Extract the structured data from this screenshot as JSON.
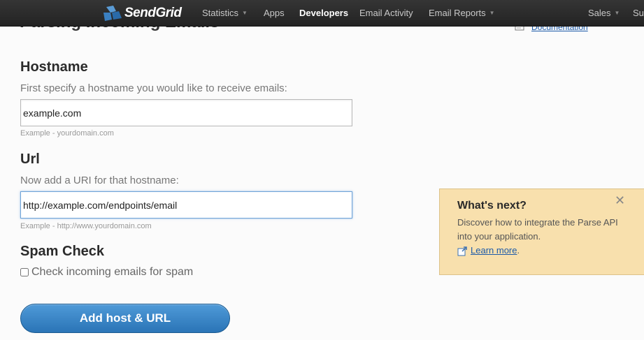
{
  "app": {
    "logo_text": "SendGrid",
    "logo_icon": "sendgrid-logo-mark"
  },
  "nav": {
    "items": [
      {
        "label": "Statistics",
        "has_dropdown": true
      },
      {
        "label": "Apps",
        "has_dropdown": false
      },
      {
        "label": "Developers",
        "has_dropdown": false,
        "active": true
      },
      {
        "label": "Email Activity",
        "has_dropdown": false
      },
      {
        "label": "Email Reports",
        "has_dropdown": true
      },
      {
        "label": "Sales",
        "has_dropdown": true
      },
      {
        "label": "Su",
        "has_dropdown": false
      }
    ],
    "caret_glyph": "▼"
  },
  "page": {
    "title": "Parsing Incoming Emails",
    "documentation_link": "Documentation"
  },
  "hostname": {
    "heading": "Hostname",
    "hint": "First specify a hostname you would like to receive emails:",
    "value": "example.com",
    "example": "Example - yourdomain.com"
  },
  "url": {
    "heading": "Url",
    "hint": "Now add a URI for that hostname:",
    "value": "http://example.com/endpoints/email",
    "example": "Example - http://www.yourdomain.com"
  },
  "spam": {
    "heading": "Spam Check",
    "checkbox_label": "Check incoming emails for spam",
    "checked": false
  },
  "submit": {
    "label": "Add host & URL"
  },
  "panel": {
    "title": "What's next?",
    "close_glyph": "✕",
    "body": "Discover how to integrate the Parse API into your application.",
    "learn_more": "Learn more",
    "learn_more_suffix": "."
  },
  "colors": {
    "nav_bg": "#2b2b2b",
    "accent": "#2f7cc0",
    "panel_bg": "#f8e0ad",
    "link": "#1c5aa8"
  }
}
